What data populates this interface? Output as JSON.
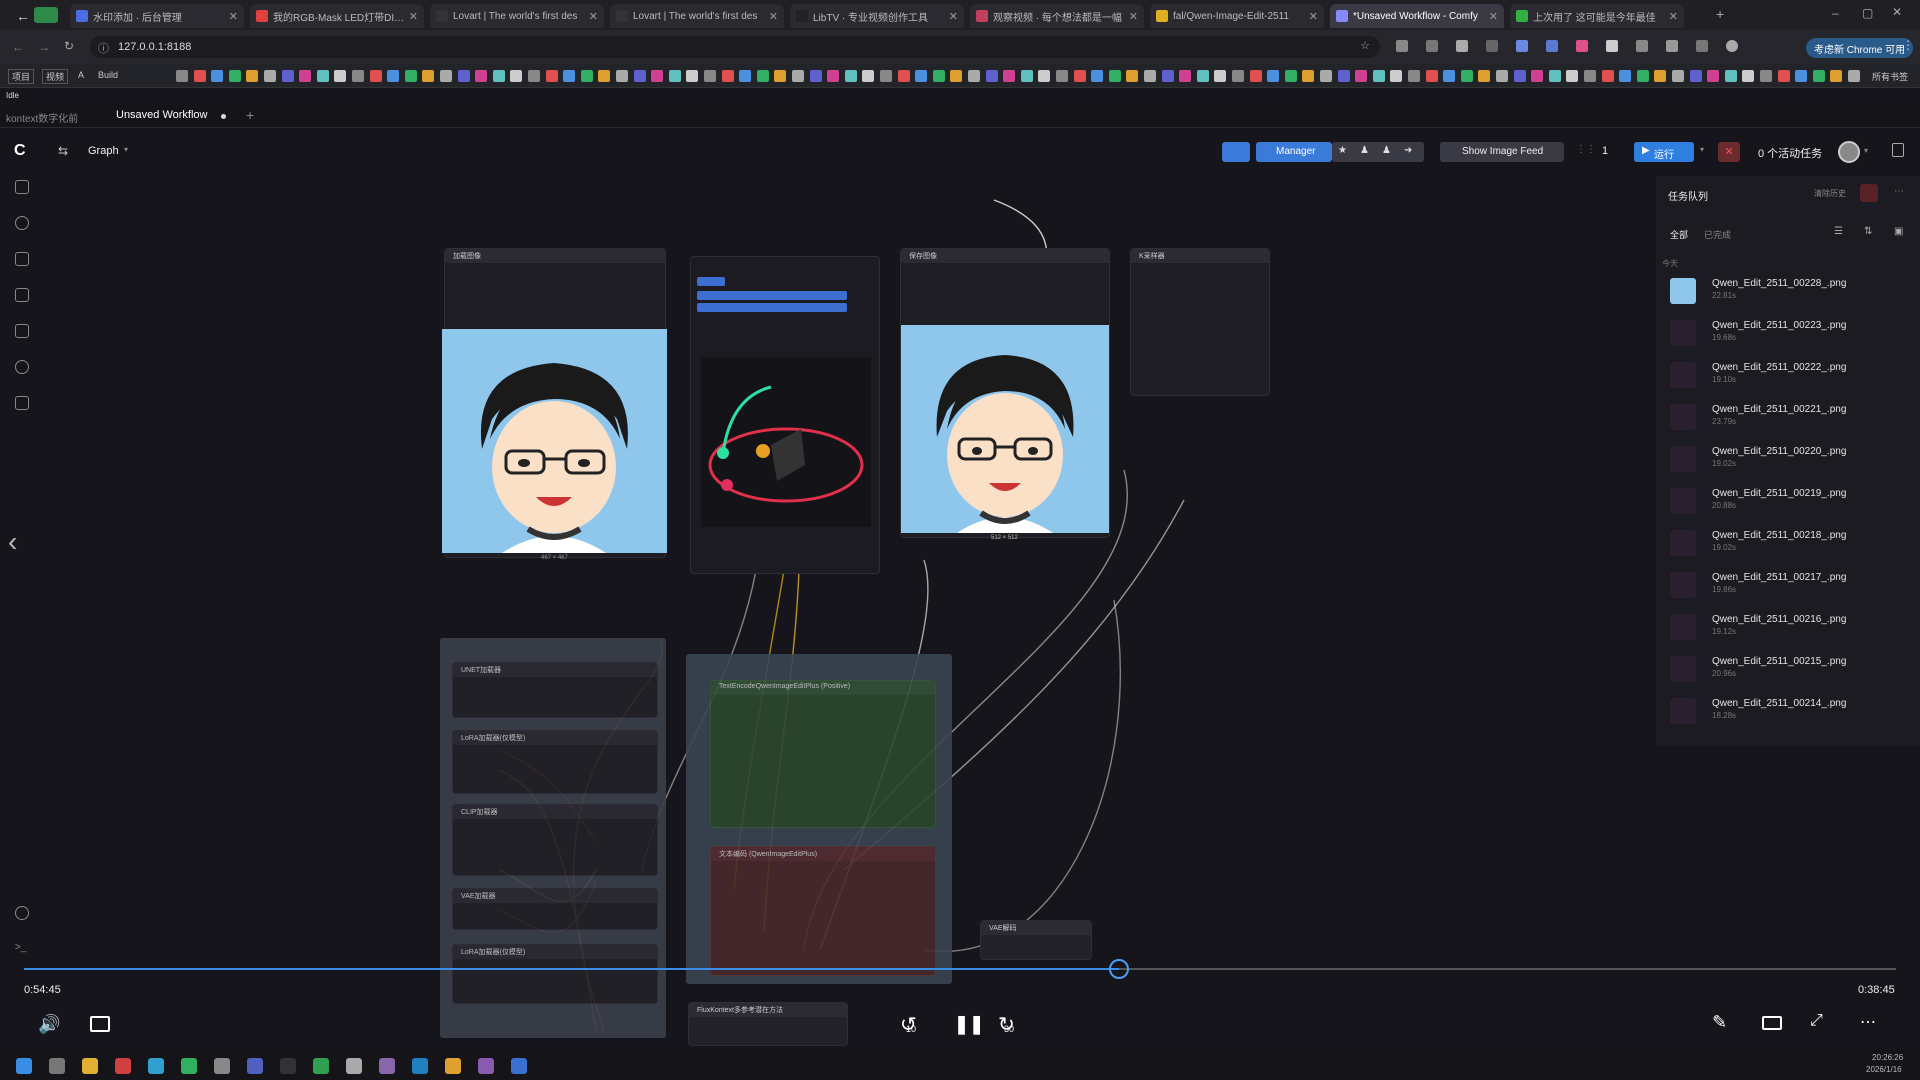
{
  "browser": {
    "tabs": [
      {
        "title": "水印添加 · 后台管理",
        "color": "#4a6ee0"
      },
      {
        "title": "我的RGB-Mask LED灯带DIY 6",
        "color": "#e04040"
      },
      {
        "title": "Lovart | The world's first des",
        "color": "#333"
      },
      {
        "title": "Lovart | The world's first des",
        "color": "#333"
      },
      {
        "title": "LibTV · 专业视频创作工具",
        "color": "#222"
      },
      {
        "title": "观察视频 · 每个想法都是一幅",
        "color": "#c04060"
      },
      {
        "title": "fal/Qwen-Image-Edit-2511",
        "color": "#e0b020"
      },
      {
        "title": "*Unsaved Workflow - Comfy",
        "color": "#8888ff"
      },
      {
        "title": "上次用了 这可能是今年最佳",
        "color": "#30b040"
      }
    ],
    "new_tab": "+",
    "url": "127.0.0.1:8188",
    "chrome_badge": "考虑新 Chrome 可用",
    "bookmarks_label_1": "项目",
    "bookmarks_label_2": "视频",
    "bookmarks_label_3": "A",
    "bookmarks_label_4": "Build",
    "bookmarks_all": "所有书签"
  },
  "app": {
    "status": "Idle",
    "tab_1": "kontext数字化前",
    "tab_2": "Unsaved Workflow",
    "add_tab": "+",
    "graph_label": "Graph",
    "manager_label": "Manager",
    "show_feed_label": "Show Image Feed",
    "batch_count": "1",
    "run_label": "运行",
    "active_tasks": "0 个活动任务"
  },
  "queue": {
    "title": "任务队列",
    "clear_label": "清除历史",
    "filter_all": "全部",
    "filter_done": "已完成",
    "section": "今天",
    "items": [
      {
        "name": "Qwen_Edit_2511_00228_.png",
        "time": "22.81s"
      },
      {
        "name": "Qwen_Edit_2511_00223_.png",
        "time": "19.68s"
      },
      {
        "name": "Qwen_Edit_2511_00222_.png",
        "time": "19.10s"
      },
      {
        "name": "Qwen_Edit_2511_00221_.png",
        "time": "23.79s"
      },
      {
        "name": "Qwen_Edit_2511_00220_.png",
        "time": "19.02s"
      },
      {
        "name": "Qwen_Edit_2511_00219_.png",
        "time": "20.88s"
      },
      {
        "name": "Qwen_Edit_2511_00218_.png",
        "time": "19.02s"
      },
      {
        "name": "Qwen_Edit_2511_00217_.png",
        "time": "19.86s"
      },
      {
        "name": "Qwen_Edit_2511_00216_.png",
        "time": "19.12s"
      },
      {
        "name": "Qwen_Edit_2511_00215_.png",
        "time": "20.96s"
      },
      {
        "name": "Qwen_Edit_2511_00214_.png",
        "time": "18.28s"
      }
    ]
  },
  "nodes": {
    "load_image": "加载图像",
    "save_image": "保存图像",
    "ksampler": "K采样器",
    "unet": "UNET加载器",
    "lora1": "LoRA加载器(仅模型)",
    "clip": "CLIP加载器",
    "vae": "VAE加载器",
    "lora2": "LoRA加载器(仅模型)",
    "encode_pos": "TextEncodeQwenImageEditPlus (Positive)",
    "encode_neg": "文本编码 (QwenImageEditPlus)",
    "vae_decode": "VAE解码",
    "flux_guidance": "FluxKontext多参考潜在方法",
    "left_caption": "467 × 467",
    "right_caption": "512 × 512"
  },
  "video": {
    "elapsed": "0:54:45",
    "remaining": "0:38:45",
    "progress": 0.585,
    "rewind": "10",
    "forward": "30"
  },
  "system": {
    "time": "20:26:26",
    "date": "2026/1/16"
  },
  "colors": {
    "accent": "#3b8ee8",
    "run": "#2f7fe0",
    "canvas": "#16151b",
    "face_bg": "#8ec6ec",
    "conditioning_green": "#2c4a2c",
    "conditioning_red": "#4a2a2c"
  }
}
